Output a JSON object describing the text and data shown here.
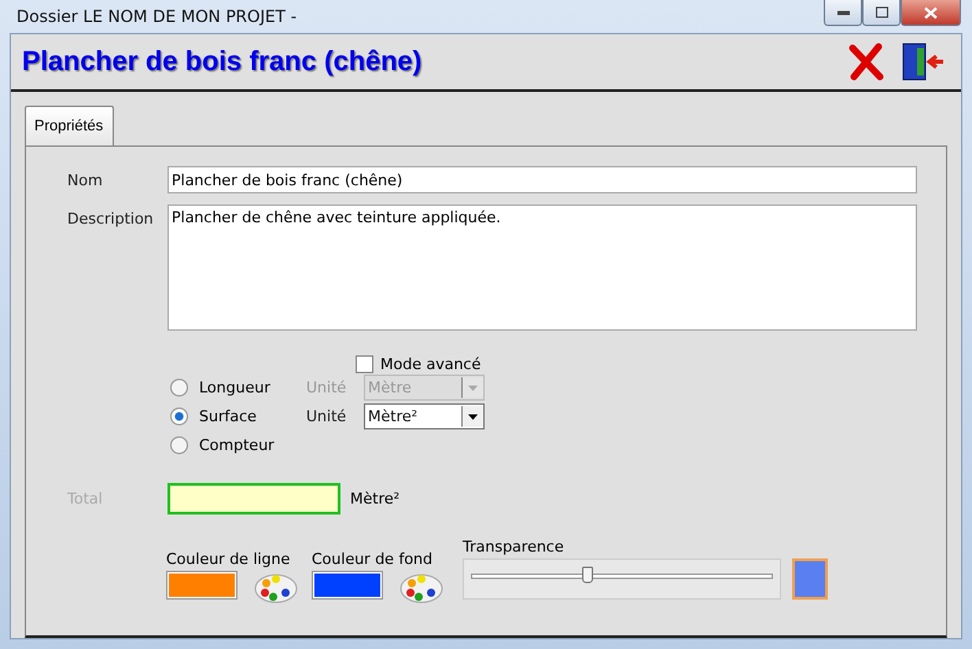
{
  "window": {
    "title": "Dossier LE NOM DE MON PROJET -"
  },
  "header": {
    "title": "Plancher de bois franc (chêne)"
  },
  "tabs": [
    {
      "label": "Propriétés",
      "selected": true
    }
  ],
  "form": {
    "name": {
      "label": "Nom",
      "value": "Plancher de bois franc (chêne)"
    },
    "description": {
      "label": "Description",
      "value": "Plancher de chêne avec teinture appliquée."
    },
    "advanced_mode": {
      "label": "Mode avancé",
      "checked": false
    },
    "measures": [
      {
        "label": "Longueur",
        "selected": false,
        "unit": {
          "label": "Unité",
          "value": "Mètre",
          "disabled": true
        }
      },
      {
        "label": "Surface",
        "selected": true,
        "unit": {
          "label": "Unité",
          "value": "Mètre²",
          "disabled": false
        }
      },
      {
        "label": "Compteur",
        "selected": false
      }
    ],
    "total": {
      "label": "Total",
      "disabled": true,
      "unit": "Mètre²"
    },
    "line_color": {
      "label": "Couleur de ligne",
      "color": "#ff8000"
    },
    "fill_color": {
      "label": "Couleur de fond",
      "color": "#0040ff"
    },
    "transparency": {
      "label": "Transparence",
      "level": 0.38
    },
    "preview": {
      "color": "#5a7ff0"
    }
  }
}
